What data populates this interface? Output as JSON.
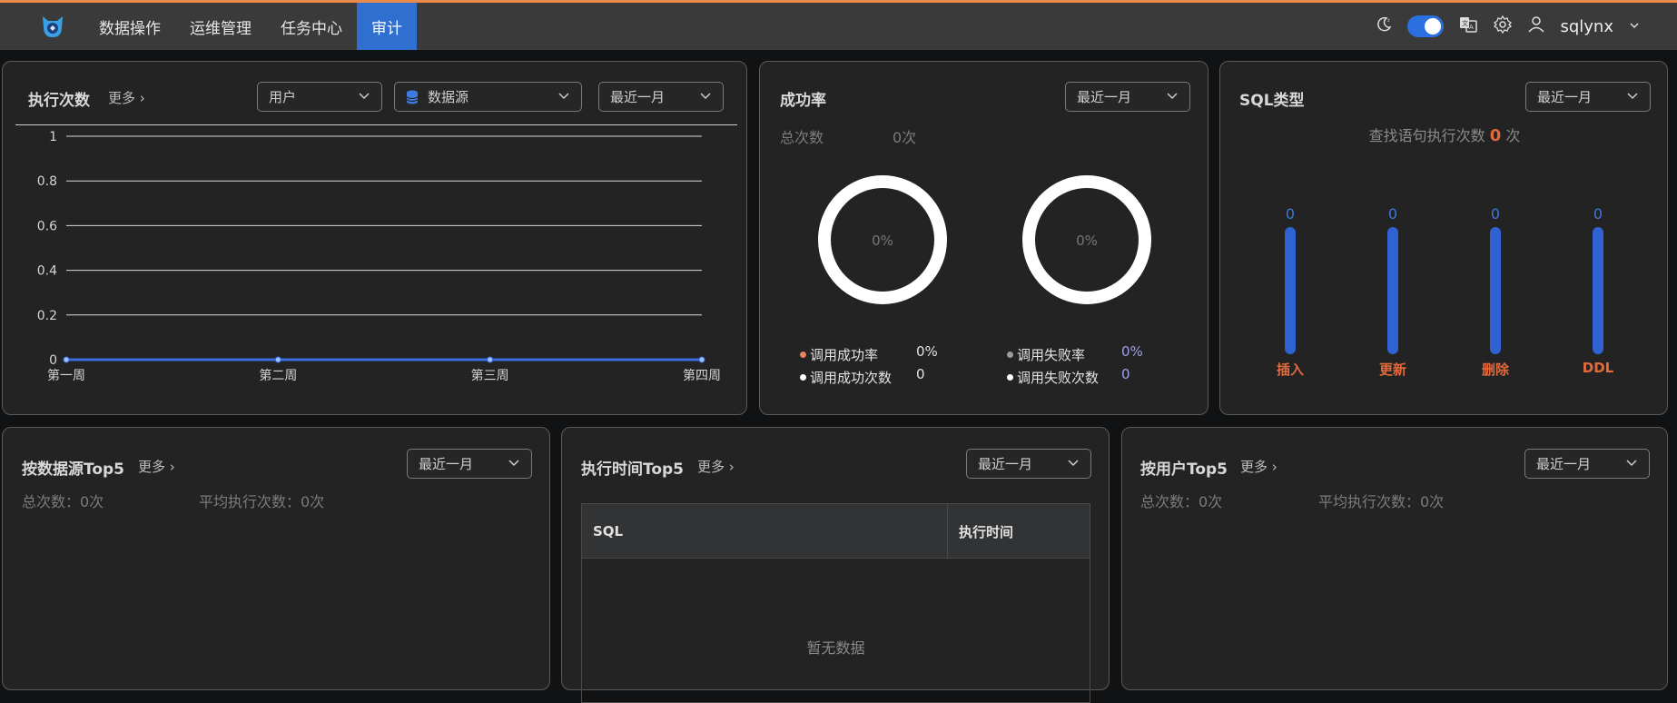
{
  "nav": {
    "items": [
      {
        "label": "数据操作"
      },
      {
        "label": "运维管理"
      },
      {
        "label": "任务中心"
      },
      {
        "label": "审计"
      }
    ],
    "user": "sqlynx"
  },
  "exec_count": {
    "title": "执行次数",
    "more": "更多",
    "filter_user": "用户",
    "filter_datasource": "数据源",
    "filter_period": "最近一月",
    "chart_data": {
      "type": "line",
      "categories": [
        "第一周",
        "第二周",
        "第三周",
        "第四周"
      ],
      "series": [
        {
          "values": [
            0,
            0,
            0,
            0
          ]
        }
      ],
      "ylim": [
        0,
        1
      ],
      "yticks": [
        "1",
        "0.8",
        "0.6",
        "0.4",
        "0.2",
        "0"
      ],
      "grid": true
    }
  },
  "success_rate": {
    "title": "成功率",
    "period": "最近一月",
    "total_label": "总次数",
    "total_value": "0次",
    "donut_left": "0%",
    "donut_right": "0%",
    "success_rate_label": "调用成功率",
    "success_rate_value": "0%",
    "success_count_label": "调用成功次数",
    "success_count_value": "0",
    "fail_rate_label": "调用失败率",
    "fail_rate_value": "0%",
    "fail_count_label": "调用失败次数",
    "fail_count_value": "0",
    "colors": {
      "success": "#e8845a",
      "fail": "#9a9a9a"
    }
  },
  "sql_type": {
    "title": "SQL类型",
    "period": "最近一月",
    "summary_prefix": "查找语句执行次数",
    "summary_value": "0",
    "summary_suffix": "次",
    "chart_data": {
      "type": "bar",
      "categories": [
        "插入",
        "更新",
        "删除",
        "DDL"
      ],
      "values": [
        0,
        0,
        0,
        0
      ]
    }
  },
  "ds_top5": {
    "title": "按数据源Top5",
    "more": "更多",
    "period": "最近一月",
    "total": "总次数：0次",
    "avg": "平均执行次数：0次"
  },
  "time_top5": {
    "title": "执行时间Top5",
    "more": "更多",
    "period": "最近一月",
    "col_sql": "SQL",
    "col_time": "执行时间",
    "empty": "暂无数据"
  },
  "user_top5": {
    "title": "按用户Top5",
    "more": "更多",
    "period": "最近一月",
    "total": "总次数：0次",
    "avg": "平均执行次数：0次"
  }
}
